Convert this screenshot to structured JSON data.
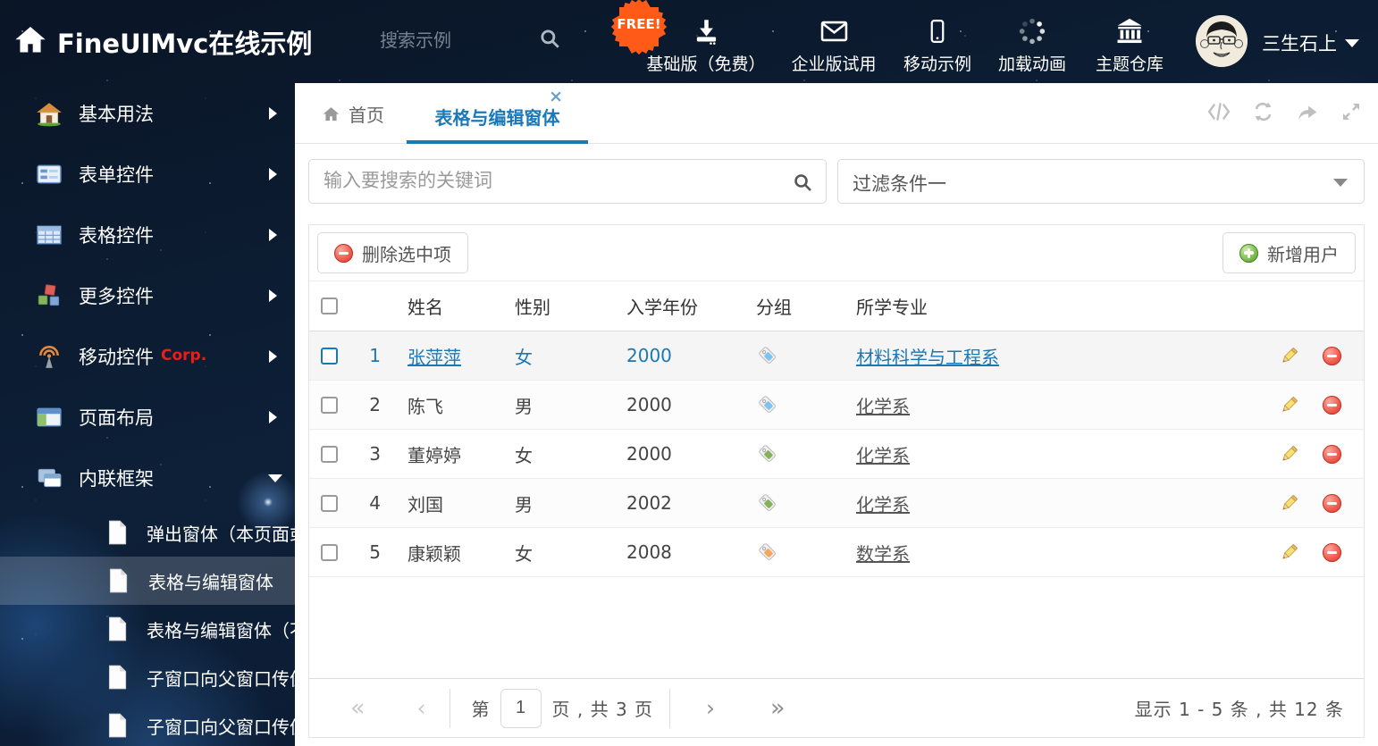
{
  "header": {
    "title": "FineUIMvc在线示例",
    "search_placeholder": "搜索示例",
    "free_badge": "FREE!",
    "nav": [
      {
        "label": "基础版（免费）",
        "icon": "download-icon"
      },
      {
        "label": "企业版试用",
        "icon": "envelope-icon"
      },
      {
        "label": "移动示例",
        "icon": "mobile-icon"
      },
      {
        "label": "加载动画",
        "icon": "spinner-icon"
      },
      {
        "label": "主题仓库",
        "icon": "bank-icon"
      }
    ],
    "user_name": "三生石上"
  },
  "sidebar": {
    "items": [
      {
        "label": "基本用法",
        "icon": "home-icon"
      },
      {
        "label": "表单控件",
        "icon": "form-icon"
      },
      {
        "label": "表格控件",
        "icon": "table-icon"
      },
      {
        "label": "更多控件",
        "icon": "cubes-icon"
      },
      {
        "label": "移动控件",
        "badge": "Corp.",
        "icon": "antenna-icon"
      },
      {
        "label": "页面布局",
        "icon": "layout-icon"
      },
      {
        "label": "内联框架",
        "icon": "frames-icon"
      }
    ],
    "subitems": [
      {
        "label": "弹出窗体（本页面或..."
      },
      {
        "label": "表格与编辑窗体"
      },
      {
        "label": "表格与编辑窗体（不..."
      },
      {
        "label": "子窗口向父窗口传值"
      },
      {
        "label": "子窗口向父窗口传值..."
      }
    ]
  },
  "tabs": {
    "home_label": "首页",
    "active_label": "表格与编辑窗体",
    "close": "×"
  },
  "filterbar": {
    "search_placeholder": "输入要搜索的关键词",
    "filter_value": "过滤条件一"
  },
  "toolbar": {
    "delete_label": "删除选中项",
    "add_label": "新增用户"
  },
  "table": {
    "columns": {
      "name": "姓名",
      "gender": "性别",
      "year": "入学年份",
      "group": "分组",
      "major": "所学专业"
    },
    "rows": [
      {
        "index": "1",
        "name": "张萍萍",
        "gender": "女",
        "year": "2000",
        "tag_style": "--tagc:#7fc3f0",
        "major": "材料科学与工程系"
      },
      {
        "index": "2",
        "name": "陈飞",
        "gender": "男",
        "year": "2000",
        "tag_style": "--tagc:#7fc3f0",
        "major": "化学系"
      },
      {
        "index": "3",
        "name": "董婷婷",
        "gender": "女",
        "year": "2000",
        "tag_style": "--tagc:#84b35c",
        "major": "化学系"
      },
      {
        "index": "4",
        "name": "刘国",
        "gender": "男",
        "year": "2002",
        "tag_style": "--tagc:#84b35c",
        "major": "化学系"
      },
      {
        "index": "5",
        "name": "康颖颖",
        "gender": "女",
        "year": "2008",
        "tag_style": "--tagc:#f4a55e",
        "major": "数学系"
      }
    ]
  },
  "pagination": {
    "first": "«",
    "prev": "‹",
    "page_prefix": "第",
    "page_value": "1",
    "page_suffix": "页 , 共 3 页",
    "next": "›",
    "last": "»",
    "summary": "显示 1 - 5 条 , 共 12 条"
  },
  "colors": {
    "accent_blue": "#1a79b8",
    "link_dark": "#555555",
    "tag_blue": "#7fc3f0",
    "tag_green": "#84b35c",
    "tag_orange": "#f4a55e",
    "danger_red": "#e04b42",
    "success_green": "#63a934",
    "corp_red": "#ee1c16"
  }
}
